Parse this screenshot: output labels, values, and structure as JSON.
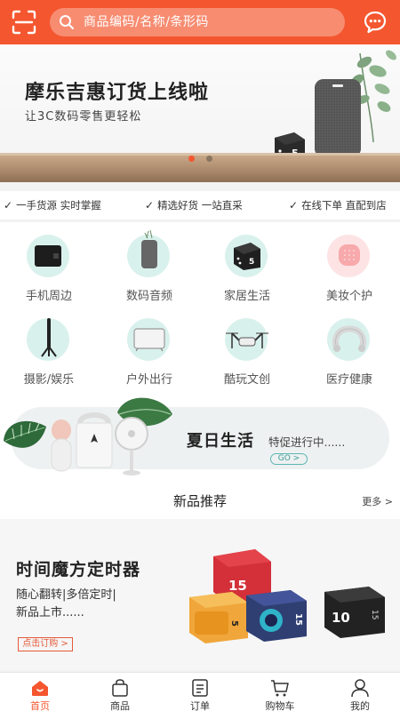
{
  "header": {
    "search_placeholder": "商品编码/名称/条形码",
    "scan_icon": "scan-icon",
    "message_icon": "chat-bubble-icon"
  },
  "banner": {
    "title": "摩乐吉惠订货上线啦",
    "subtitle": "让3C数码零售更轻松",
    "carousel_active": 0,
    "carousel_count": 2,
    "cube_number": "5"
  },
  "features": [
    {
      "label": "一手货源 实时掌握"
    },
    {
      "label": "精选好货 一站直采"
    },
    {
      "label": "在线下单 直配到店"
    }
  ],
  "categories": [
    {
      "label": "手机周边",
      "icon": "power-bank-icon"
    },
    {
      "label": "数码音频",
      "icon": "speaker-icon"
    },
    {
      "label": "家居生活",
      "icon": "cube-timer-icon"
    },
    {
      "label": "美妆个护",
      "icon": "beauty-device-icon"
    },
    {
      "label": "摄影/娱乐",
      "icon": "selfie-stick-icon"
    },
    {
      "label": "户外出行",
      "icon": "bag-icon"
    },
    {
      "label": "酷玩文创",
      "icon": "drone-icon"
    },
    {
      "label": "医疗健康",
      "icon": "neck-massager-icon"
    }
  ],
  "promo": {
    "title": "夏日生活",
    "subtitle": "特促进行中......",
    "go_label": "GO >"
  },
  "new_products": {
    "title": "新品推荐",
    "more_label": "更多 >"
  },
  "timer_card": {
    "title": "时间魔方定时器",
    "desc_line1": "随心翻转|多倍定时|",
    "desc_line2": "新品上市......",
    "order_label": "点击订购 >",
    "cube_labels": [
      "15",
      "5",
      "15",
      "10",
      "15"
    ]
  },
  "tabbar": {
    "active": 0,
    "tabs": [
      {
        "label": "首页",
        "icon": "home-icon"
      },
      {
        "label": "商品",
        "icon": "bag-icon"
      },
      {
        "label": "订单",
        "icon": "list-icon"
      },
      {
        "label": "购物车",
        "icon": "cart-icon"
      },
      {
        "label": "我的",
        "icon": "user-icon"
      }
    ]
  },
  "colors": {
    "brand": "#f4562f",
    "accent_teal": "#5bb7b4"
  }
}
